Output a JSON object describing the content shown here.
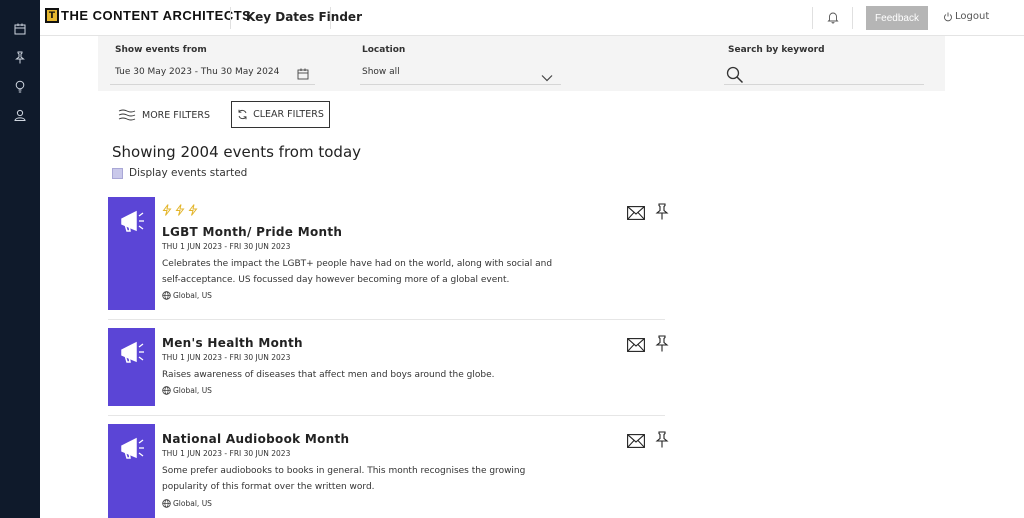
{
  "header": {
    "logo_mark": "T",
    "logo_text": "THE CONTENT ARCHITECTS",
    "app_title": "Key Dates Finder",
    "feedback_label": "Feedback",
    "logout_label": "Logout"
  },
  "sidebar": {
    "icons": [
      "calendar-icon",
      "pin-icon",
      "lightbulb-icon",
      "user-icon"
    ]
  },
  "filters": {
    "show_events_label": "Show events from",
    "date_range": "Tue 30 May 2023 - Thu 30 May 2024",
    "location_label": "Location",
    "location_value": "Show all",
    "search_label": "Search by keyword",
    "search_value": "",
    "more_filters_label": "MORE FILTERS",
    "clear_filters_label": "CLEAR FILTERS"
  },
  "results": {
    "showing_text": "Showing 2004 events from today",
    "display_started_label": "Display events started"
  },
  "events": [
    {
      "title": "LGBT Month/ Pride Month",
      "dates": "THU 1 JUN 2023 - FRI 30 JUN 2023",
      "description": "Celebrates the impact the LGBT+ people have had on the world, along with social and self-acceptance. US focussed day however becoming more of a global event.",
      "location": "Global, US",
      "popularity": 3
    },
    {
      "title": "Men's Health Month",
      "dates": "THU 1 JUN 2023 - FRI 30 JUN 2023",
      "description": "Raises awareness of diseases that affect men and boys around the globe.",
      "location": "Global, US",
      "popularity": 0
    },
    {
      "title": "National Audiobook Month",
      "dates": "THU 1 JUN 2023 - FRI 30 JUN 2023",
      "description": "Some prefer audiobooks to books in general. This month recognises the growing popularity of this format over the written word.",
      "location": "Global, US",
      "popularity": 0
    }
  ],
  "colors": {
    "sidebar_bg": "#0f1a2b",
    "accent_purple": "#5b45d6",
    "bolt_yellow": "#e3b52b",
    "feedback_bg": "#b5b5b5"
  }
}
